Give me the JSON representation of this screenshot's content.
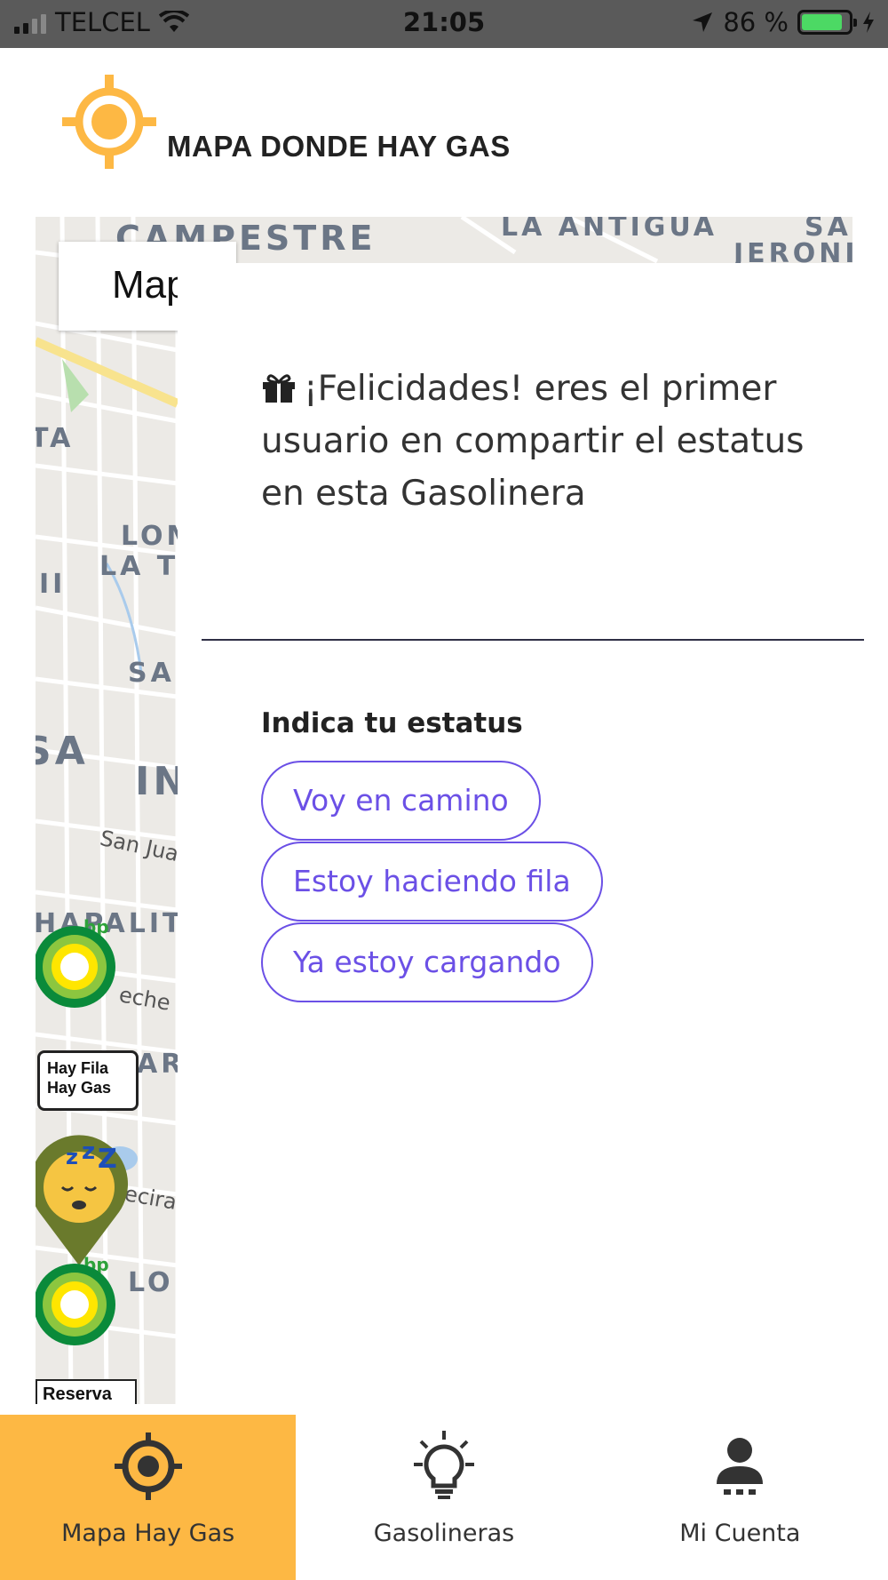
{
  "status_bar": {
    "carrier": "TELCEL",
    "time": "21:05",
    "battery": "86 %"
  },
  "header": {
    "title": "MAPA DONDE HAY GAS"
  },
  "map": {
    "map_type_label": "Map",
    "labels": [
      "LA ANTIGUA",
      "CAMPESTRE",
      "SAN",
      "JERONI",
      "LOM",
      "LA T",
      "SA",
      "IN",
      "San Jua",
      "HAPALIT",
      "eche",
      "ecira",
      "LO",
      "TA",
      "II",
      "SA",
      "AR"
    ],
    "bubble_text": [
      "Hay Fila",
      "Hay Gas"
    ],
    "reserva_text": "Reserva"
  },
  "modal": {
    "message": "¡Felicidades! eres el primer usuario en compartir el estatus en esta Gasolinera",
    "status_title": "Indica tu estatus",
    "buttons": [
      "Voy en camino",
      "Estoy haciendo fila",
      "Ya estoy cargando"
    ]
  },
  "nav": {
    "items": [
      {
        "label": "Mapa Hay Gas",
        "icon": "crosshair-icon"
      },
      {
        "label": "Gasolineras",
        "icon": "lightbulb-icon"
      },
      {
        "label": "Mi Cuenta",
        "icon": "user-icon"
      }
    ]
  },
  "colors": {
    "accent": "#fdb844",
    "button": "#6b50e6",
    "battery": "#4cd964"
  }
}
